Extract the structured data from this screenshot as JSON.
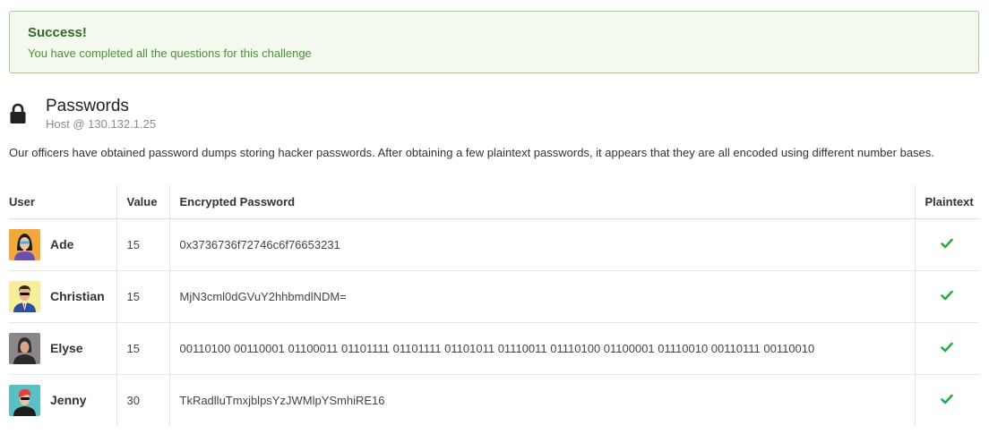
{
  "alert": {
    "title": "Success!",
    "message": "You have completed all the questions for this challenge"
  },
  "challenge": {
    "icon": "lock-icon",
    "title": "Passwords",
    "host": "Host @ 130.132.1.25",
    "description": "Our officers have obtained password dumps storing hacker passwords. After obtaining a few plaintext passwords, it appears that they are all encoded using different number bases."
  },
  "table": {
    "headers": {
      "user": "User",
      "value": "Value",
      "encrypted": "Encrypted Password",
      "plaintext": "Plaintext"
    },
    "rows": [
      {
        "user": "Ade",
        "value": "15",
        "password": "0x3736736f72746c6f76653231",
        "status": "check-icon"
      },
      {
        "user": "Christian",
        "value": "15",
        "password": "MjN3cml0dGVuY2hhbmdlNDM=",
        "status": "check-icon"
      },
      {
        "user": "Elyse",
        "value": "15",
        "password": "00110100 00110001 01100011 01101111 01101111 01101011 01110011 01110100 01100001 01110010 00110111 00110010",
        "status": "check-icon"
      },
      {
        "user": "Jenny",
        "value": "30",
        "password": "TkRadlluTmxjblpsYzJWMlpYSmhiRE16",
        "status": "check-icon"
      }
    ]
  },
  "colors": {
    "alert_bg": "#f4f9ee",
    "alert_border": "#a8cf93",
    "success_text": "#2f6a26",
    "check_green": "#2eaa4a"
  }
}
